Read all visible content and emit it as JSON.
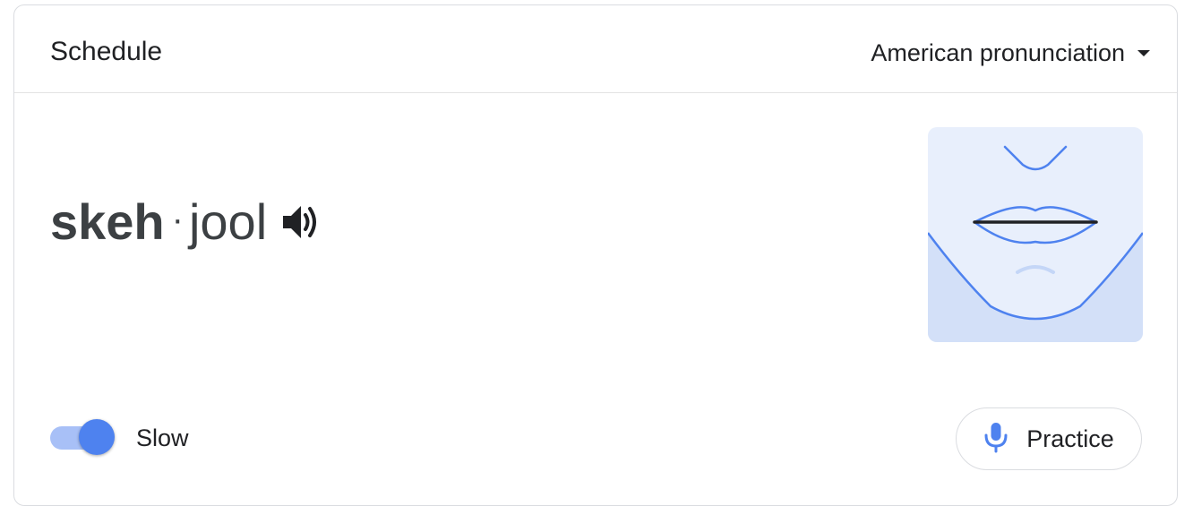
{
  "header": {
    "title": "Schedule",
    "accent_dropdown": {
      "selected": "American pronunciation",
      "icon": "caret-down-icon"
    }
  },
  "pronunciation": {
    "stressed_syllable": "skeh",
    "separator": "·",
    "unstressed_syllable": "jool",
    "play_icon": "speaker-icon"
  },
  "illustration": {
    "description_icon": "mouth-position-icon"
  },
  "footer": {
    "slow_toggle": {
      "label": "Slow",
      "on": true
    },
    "practice_button": {
      "label": "Practice",
      "icon": "microphone-icon"
    }
  },
  "colors": {
    "accent": "#4e82ef",
    "accent_light": "#a8c0f7",
    "mouth_bg_top": "#e8effc",
    "mouth_bg_bottom": "#d3e0f8",
    "text": "#202124"
  }
}
